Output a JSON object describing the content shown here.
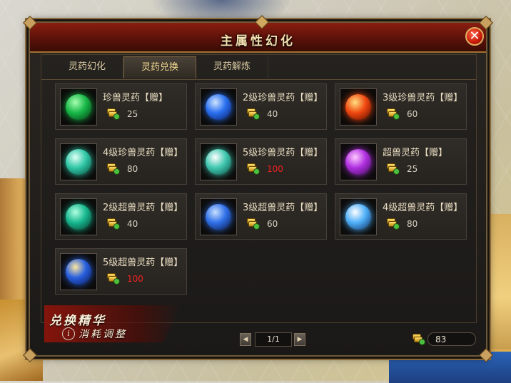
{
  "window": {
    "title": "主属性幻化",
    "close_label": "✕"
  },
  "tabs": [
    {
      "label": "灵药幻化",
      "active": false
    },
    {
      "label": "灵药兑换",
      "active": true
    },
    {
      "label": "灵药解炼",
      "active": false
    }
  ],
  "items": [
    {
      "name": "珍兽灵药【赠】",
      "price": "25",
      "price_color": "normal",
      "orb_colors": [
        "#a8ffb0",
        "#18b848",
        "#043a14"
      ]
    },
    {
      "name": "2级珍兽灵药【赠】",
      "price": "40",
      "price_color": "normal",
      "orb_colors": [
        "#cfe4ff",
        "#2a70f0",
        "#061a60"
      ]
    },
    {
      "name": "3级珍兽灵药【赠】",
      "price": "60",
      "price_color": "normal",
      "orb_colors": [
        "#ffe080",
        "#f04810",
        "#5a0a00"
      ]
    },
    {
      "name": "4级珍兽灵药【赠】",
      "price": "80",
      "price_color": "normal",
      "orb_colors": [
        "#e0fff4",
        "#30c8a8",
        "#064a3a"
      ]
    },
    {
      "name": "5级珍兽灵药【赠】",
      "price": "100",
      "price_color": "red",
      "orb_colors": [
        "#ffffff",
        "#40c8b0",
        "#0a4a40"
      ]
    },
    {
      "name": "超兽灵药【赠】",
      "price": "25",
      "price_color": "normal",
      "orb_colors": [
        "#ffc8ff",
        "#b030e0",
        "#3a0a50"
      ]
    },
    {
      "name": "2级超兽灵药【赠】",
      "price": "40",
      "price_color": "normal",
      "orb_colors": [
        "#b0ffe0",
        "#18b890",
        "#043a2a"
      ]
    },
    {
      "name": "3级超兽灵药【赠】",
      "price": "60",
      "price_color": "normal",
      "orb_colors": [
        "#c8e0ff",
        "#3070e8",
        "#08184a"
      ]
    },
    {
      "name": "4级超兽灵药【赠】",
      "price": "80",
      "price_color": "normal",
      "orb_colors": [
        "#ffffff",
        "#50b0f8",
        "#0a2a60"
      ]
    },
    {
      "name": "5级超兽灵药【赠】",
      "price": "100",
      "price_color": "red",
      "orb_colors": [
        "#ffe8a0",
        "#2860e0",
        "#081850"
      ]
    }
  ],
  "pager": {
    "text": "1/1",
    "prev_icon": "◀",
    "next_icon": "▶"
  },
  "balance": {
    "value": "83"
  },
  "footer": {
    "title": "兑换精华",
    "subtitle": "消耗调整",
    "info_icon": "i"
  }
}
